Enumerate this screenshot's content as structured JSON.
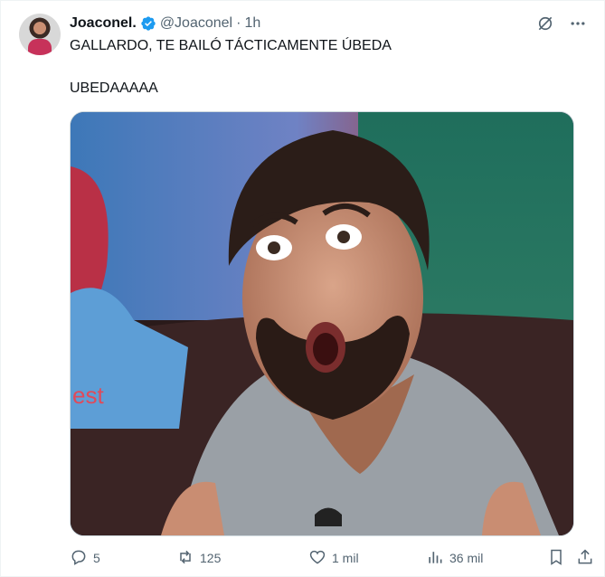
{
  "tweet": {
    "display_name": "Joaconel.",
    "handle": "@Joaconel",
    "separator": "·",
    "time": "1h",
    "text_line1": "GALLARDO, TE BAILÓ TÁCTICAMENTE ÚBEDA",
    "text_line2": "UBEDAAAAA",
    "media_overlay_text": "est"
  },
  "actions": {
    "replies": "5",
    "reposts": "125",
    "likes": "1 mil",
    "views": "36 mil"
  },
  "icons": {
    "verified": "verified-badge-icon",
    "grok": "grok-icon",
    "more": "more-icon",
    "reply": "reply-icon",
    "repost": "repost-icon",
    "like": "heart-icon",
    "views": "views-chart-icon",
    "bookmark": "bookmark-icon",
    "share": "share-icon"
  },
  "colors": {
    "verified": "#1d9bf0",
    "secondary_text": "#536471",
    "primary_text": "#0f1419"
  }
}
